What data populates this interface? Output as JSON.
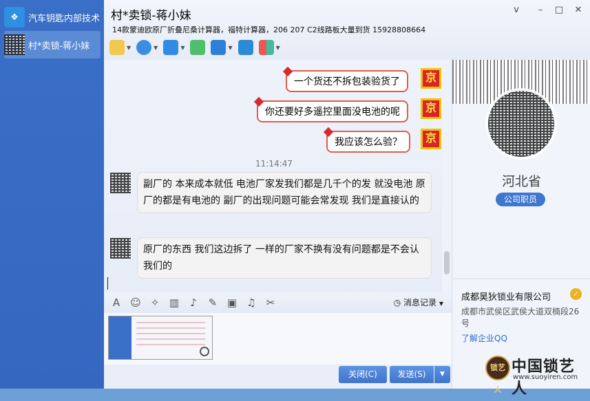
{
  "sidebar": {
    "items": [
      {
        "label": "汽车钥匙内部技术",
        "icon": "group-logo-icon"
      },
      {
        "label": "村*卖锁-蒋小妹",
        "icon": "avatar-qr"
      }
    ]
  },
  "header": {
    "title": "村*卖锁-蒋小妹",
    "subtitle": "14款蒙迪欧原厂折叠尼桑计算器，福特计算器，206 207 C2线路板大量到货 15928808664",
    "window_controls": [
      "v",
      "–",
      "□",
      "✕"
    ]
  },
  "toolbar": {
    "items": [
      "microphone-icon",
      "video-camera-icon",
      "file-transfer-icon",
      "add-chat-icon",
      "remote-desktop-icon",
      "share-screen-icon",
      "apps-icon"
    ]
  },
  "chat": {
    "sent": [
      {
        "text": "一个货还不拆包装验货了"
      },
      {
        "text": "你还要好多遥控里面没电池的呢"
      },
      {
        "text": "我应该怎么验？"
      }
    ],
    "stamp_char": "京",
    "timestamp": "11:14:47",
    "received": [
      {
        "text": "副厂的 本来成本就低 电池厂家发我们都是几千个的发 就没电池 原厂的都是有电池的 副厂的出现问题可能会常发现 我们是直接认的"
      },
      {
        "text": "原厂的东西 我们这边拆了 一样的厂家不换有没有问题都是不会认我们的"
      }
    ]
  },
  "input_toolbar": {
    "icons": [
      "font-icon",
      "emoji-icon",
      "magic-icon",
      "screenshot-icon",
      "voice-icon",
      "edit-icon",
      "image-icon",
      "music-icon",
      "scissors-icon"
    ],
    "history_label": "消息记录"
  },
  "footer": {
    "close_label": "关闭(C)",
    "send_label": "发送(S)",
    "send_dropdown": "▼"
  },
  "profile": {
    "province": "河北省",
    "role": "公司职员",
    "company": "成都昊狄锁业有限公司",
    "address": "成都市武侯区武侯大道双楠段26号",
    "link": "了解企业QQ",
    "brand_text": "中国锁艺人",
    "brand_url": "www.suoyiren.com",
    "brand_badge": "锁艺人"
  }
}
